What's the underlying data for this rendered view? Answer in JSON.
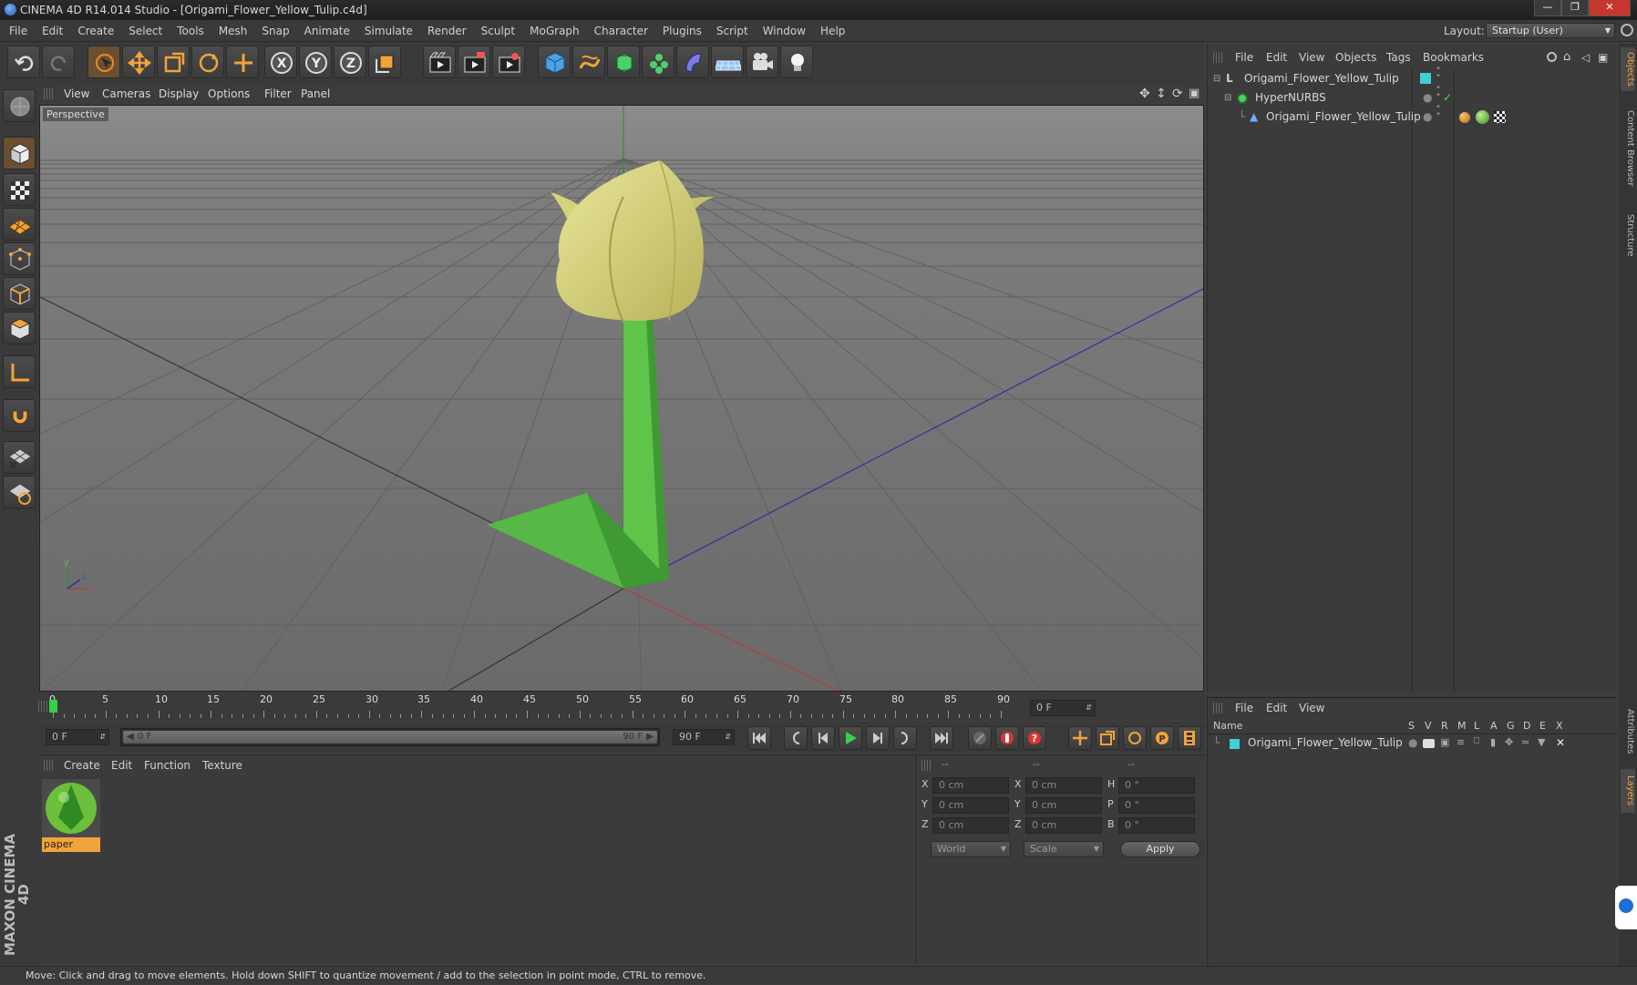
{
  "window": {
    "title": "CINEMA 4D R14.014 Studio - [Origami_Flower_Yellow_Tulip.c4d]",
    "controls": [
      "minimize",
      "restore",
      "close"
    ]
  },
  "menubar": [
    "File",
    "Edit",
    "Create",
    "Select",
    "Tools",
    "Mesh",
    "Snap",
    "Animate",
    "Simulate",
    "Render",
    "Sculpt",
    "MoGraph",
    "Character",
    "Plugins",
    "Script",
    "Window",
    "Help"
  ],
  "layout": {
    "label": "Layout:",
    "value": "Startup (User)"
  },
  "viewport": {
    "menu": [
      "View",
      "Cameras",
      "Display",
      "Options",
      "Filter",
      "Panel"
    ],
    "badge": "Perspective",
    "axis": {
      "y": "y",
      "x": "x",
      "z": "z"
    }
  },
  "timeline": {
    "ticks": [
      "0",
      "5",
      "10",
      "15",
      "20",
      "25",
      "30",
      "35",
      "40",
      "45",
      "50",
      "55",
      "60",
      "65",
      "70",
      "75",
      "80",
      "85",
      "90"
    ],
    "current_frame": "0 F"
  },
  "transport": {
    "start": "0 F",
    "range_start": "0 F",
    "range_end": "90 F",
    "end": "90 F"
  },
  "materials": {
    "menu": [
      "Create",
      "Edit",
      "Function",
      "Texture"
    ],
    "items": [
      {
        "name": "paper"
      }
    ]
  },
  "coords": {
    "headers": [
      "--",
      "--",
      "--"
    ],
    "rows": [
      {
        "a": "X",
        "av": "0 cm",
        "b": "X",
        "bv": "0 cm",
        "c": "H",
        "cv": "0 °"
      },
      {
        "a": "Y",
        "av": "0 cm",
        "b": "Y",
        "bv": "0 cm",
        "c": "P",
        "cv": "0 °"
      },
      {
        "a": "Z",
        "av": "0 cm",
        "b": "Z",
        "bv": "0 cm",
        "c": "B",
        "cv": "0 °"
      }
    ],
    "mode": "World",
    "size": "Scale",
    "apply": "Apply"
  },
  "objects": {
    "menu": [
      "File",
      "Edit",
      "View",
      "Objects",
      "Tags",
      "Bookmarks"
    ],
    "tree": [
      {
        "name": "Origami_Flower_Yellow_Tulip"
      },
      {
        "name": "HyperNURBS"
      },
      {
        "name": "Origami_Flower_Yellow_Tulip"
      }
    ]
  },
  "layers": {
    "menu": [
      "File",
      "Edit",
      "View"
    ],
    "columns": [
      "Name",
      "S",
      "V",
      "R",
      "M",
      "L",
      "A",
      "G",
      "D",
      "E",
      "X"
    ],
    "rows": [
      {
        "name": "Origami_Flower_Yellow_Tulip"
      }
    ]
  },
  "side_tabs": [
    "Objects",
    "Content Browser",
    "Structure",
    "Attributes",
    "Layers"
  ],
  "brand": "MAXON CINEMA 4D",
  "status": "Move: Click and drag to move elements. Hold down SHIFT to quantize movement / add to the selection in point mode, CTRL to remove."
}
